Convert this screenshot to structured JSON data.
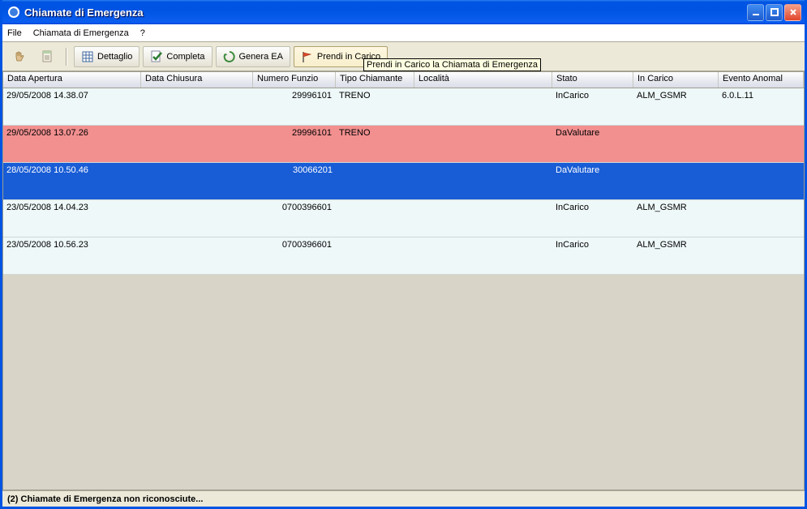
{
  "titlebar": {
    "title": "Chiamate di Emergenza"
  },
  "menubar": {
    "file": "File",
    "chiamata": "Chiamata di Emergenza",
    "help": "?"
  },
  "toolbar": {
    "dettaglio": "Dettaglio",
    "completa": "Completa",
    "genera_ea": "Genera EA",
    "prendi_in_carico": "Prendi in Carico"
  },
  "tooltip": "Prendi in Carico la Chiamata di Emergenza",
  "columns": {
    "c0": "Data Apertura",
    "c1": "Data Chiusura",
    "c2": "Numero Funzio",
    "c3": "Tipo Chiamante",
    "c4": "Località",
    "c5": "Stato",
    "c6": "In Carico",
    "c7": "Evento Anomal"
  },
  "rows": [
    {
      "class": "",
      "c0": "29/05/2008 14.38.07",
      "c1": "",
      "c2": "29996101",
      "c3": "TRENO",
      "c4": "",
      "c5": "InCarico",
      "c6": "ALM_GSMR",
      "c7": "6.0.L.11"
    },
    {
      "class": "pink",
      "c0": "29/05/2008 13.07.26",
      "c1": "",
      "c2": "29996101",
      "c3": "TRENO",
      "c4": "",
      "c5": "DaValutare",
      "c6": "",
      "c7": ""
    },
    {
      "class": "blue",
      "c0": "28/05/2008 10.50.46",
      "c1": "",
      "c2": "30066201",
      "c3": "",
      "c4": "",
      "c5": "DaValutare",
      "c6": "",
      "c7": ""
    },
    {
      "class": "",
      "c0": "23/05/2008 14.04.23",
      "c1": "",
      "c2": "0700396601",
      "c3": "",
      "c4": "",
      "c5": "InCarico",
      "c6": "ALM_GSMR",
      "c7": ""
    },
    {
      "class": "",
      "c0": "23/05/2008 10.56.23",
      "c1": "",
      "c2": "0700396601",
      "c3": "",
      "c4": "",
      "c5": "InCarico",
      "c6": "ALM_GSMR",
      "c7": ""
    }
  ],
  "statusbar": "(2) Chiamate di Emergenza non riconosciute..."
}
